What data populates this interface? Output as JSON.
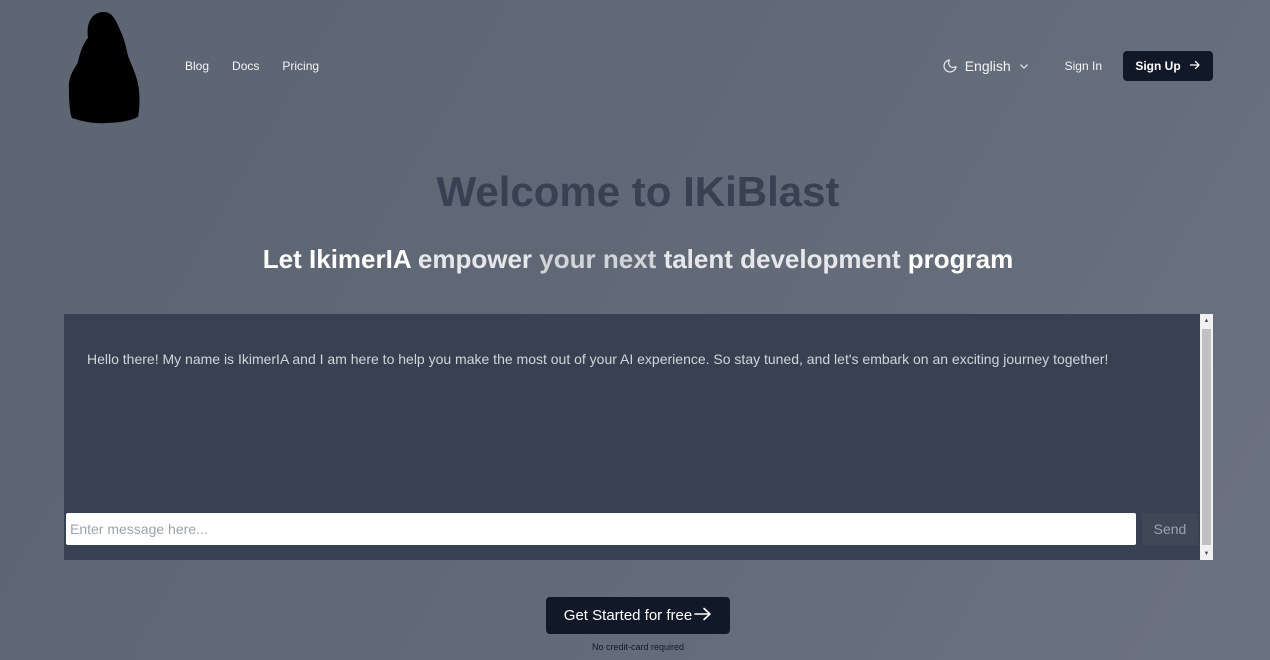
{
  "header": {
    "logo_icon": "hooded-figure-logo",
    "nav": [
      "Blog",
      "Docs",
      "Pricing"
    ],
    "theme_icon": "moon-icon",
    "language": "English",
    "sign_in": "Sign In",
    "sign_up": "Sign Up"
  },
  "hero": {
    "title": "Welcome to IKiBlast",
    "tagline_parts": [
      "Let IkimerIA",
      "empower",
      "your next",
      "talent development",
      "program"
    ]
  },
  "chat": {
    "message": "Hello there! My name is IkimerIA and I am here to help you make the most out of your AI experience. So stay tuned, and let's embark on an exciting journey together!",
    "input_placeholder": "Enter message here...",
    "input_value": "",
    "send_label": "Send"
  },
  "cta": {
    "label": "Get Started for free",
    "note": "No credit-card required"
  }
}
